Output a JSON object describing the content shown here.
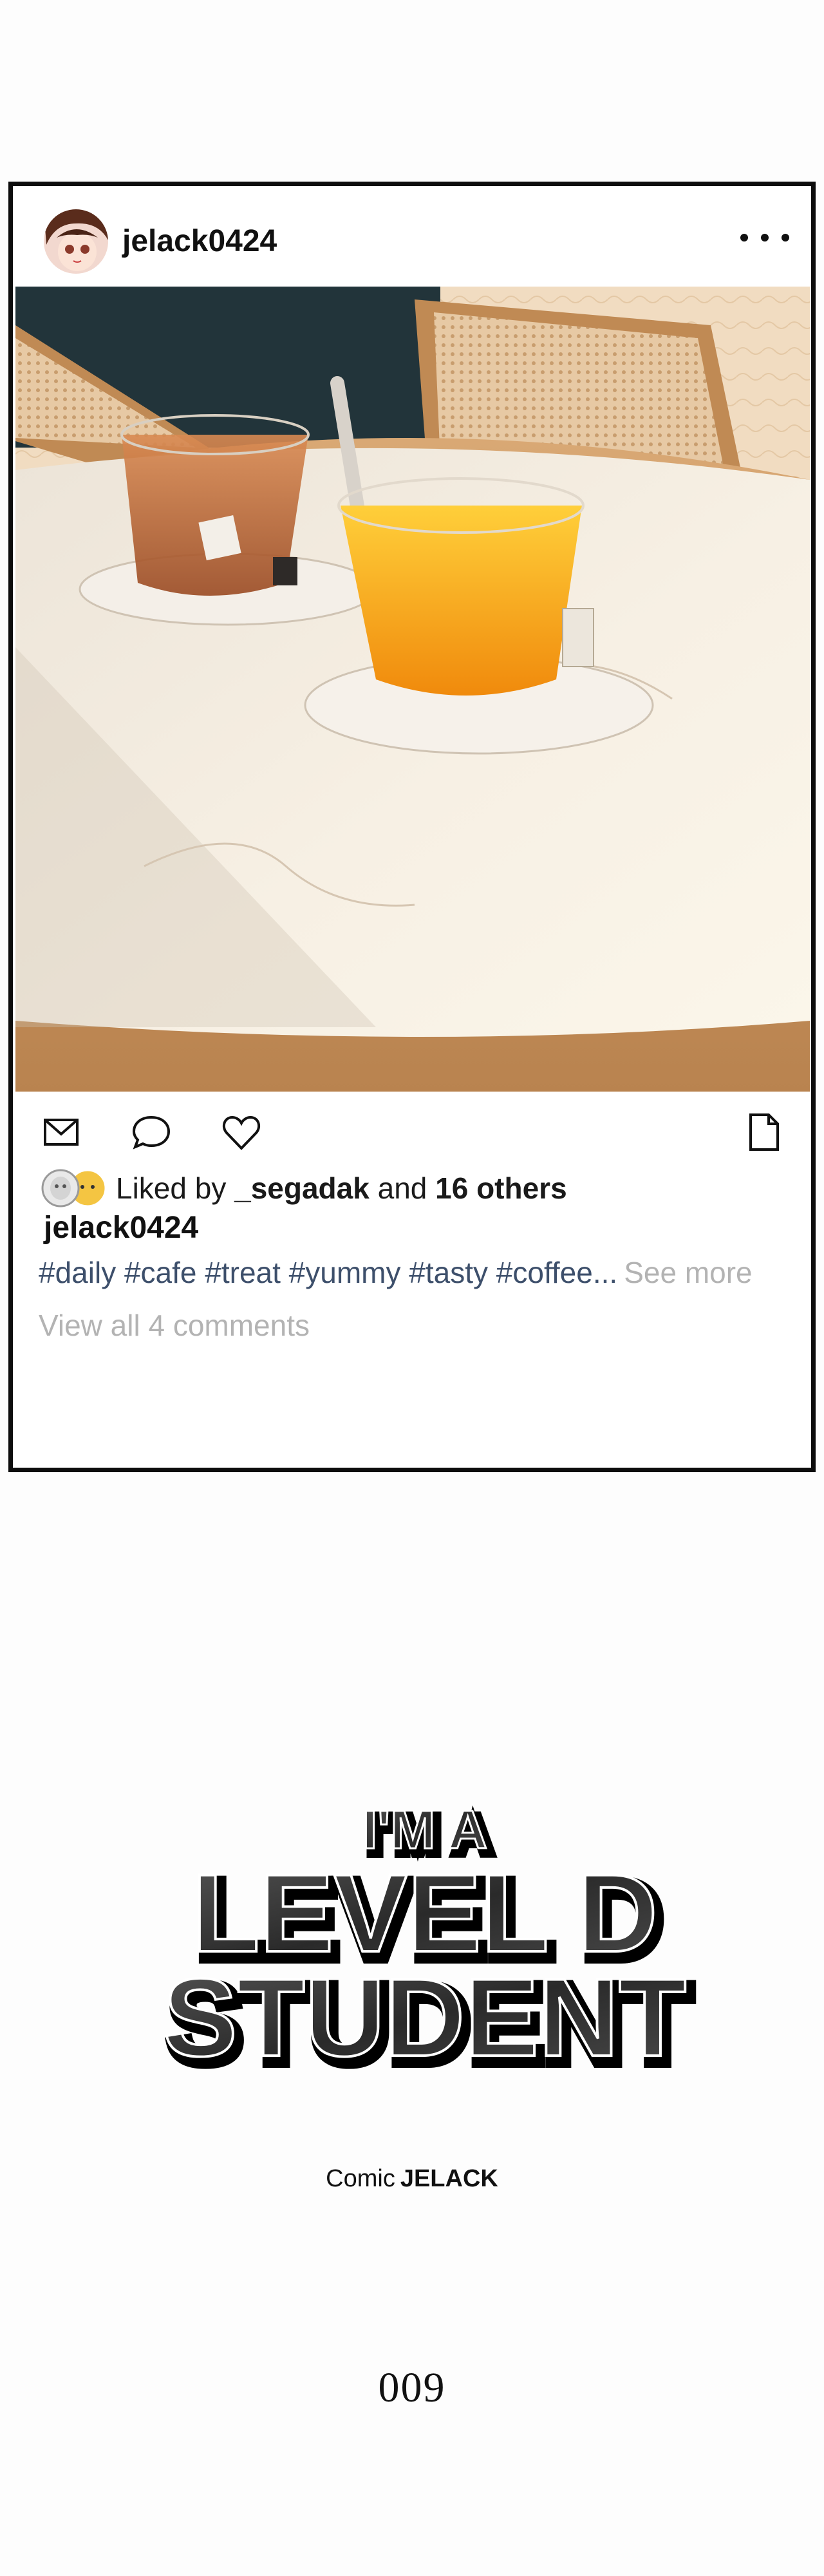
{
  "post": {
    "username": "jelack0424",
    "image_alt": "two cups of tea on a cafe table",
    "actions": [
      "mail-icon",
      "comment-icon",
      "heart-icon",
      "bookmark-icon"
    ],
    "likes": {
      "prefix": "Liked by",
      "liker": "_segadak",
      "joiner": "and",
      "others": "16 others"
    },
    "caption_user": "jelack0424",
    "hashtags": "#daily #cafe #treat #yummy #tasty #coffee...",
    "see_more": "See more",
    "view_comments": "View all 4 comments"
  },
  "title": {
    "line1": "I'M A",
    "line2": "LEVEL D",
    "line3": "STUDENT"
  },
  "credit": {
    "prefix": "Comic",
    "author": "JELACK"
  },
  "chapter": "009",
  "colors": {
    "border": "#0d0d0d",
    "hashtag": "#3d4f6b",
    "muted": "#b3b3b3",
    "tea_orange": "#f5a11a",
    "tea_amber": "#c8682a"
  }
}
